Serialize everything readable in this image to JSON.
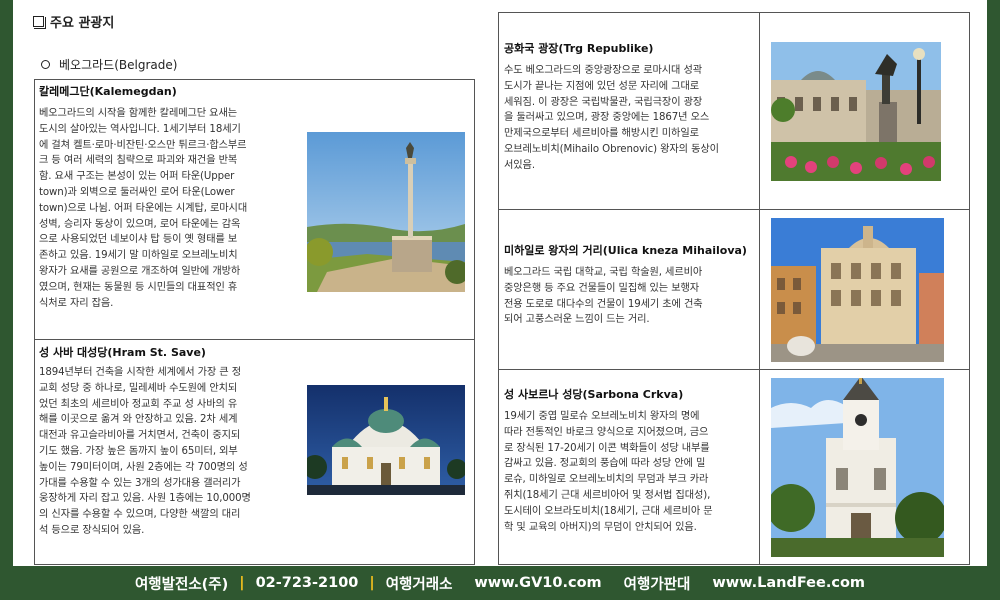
{
  "header": {
    "section_title": "주요 관광지",
    "city_title": "베오그라드(Belgrade)"
  },
  "cards": {
    "kalemegdan": {
      "title": "칼레메그단(Kalemegdan)",
      "lines": [
        "베오그라드의 시작을 함께한 칼레메그단 요새는",
        "도시의 살아있는 역사입니다. 1세기부터 18세기",
        "에 걸쳐 켈트·로마·비잔틴·오스만 튀르크·합스부르",
        "크 등 여러 세력의 침략으로 파괴와 재건을 반복",
        "함.  요새 구조는 본성이 있는 어퍼 타운(Upper",
        "town)과  외벽으로  둘러싸인  로어  타운(Lower",
        "town)으로 나뉨. 어퍼 타운에는 시계탑, 로마시대",
        "성벽, 승리자 동상이 있으며, 로어 타운에는 감옥",
        "으로 사용되었던 네보이샤 탑 등이 옛 형태를 보",
        "존하고 있음. 19세기 말 미하일로 오브레노비치",
        "왕자가 요새를 공원으로 개조하여 일반에 개방하",
        "였으며, 현재는 동물원 등 시민들의 대표적인 휴",
        "식처로 자리 잡음."
      ]
    },
    "sava": {
      "title": "성 사바 대성당(Hram St. Save)",
      "lines": [
        "1894년부터 건축을 시작한 세계에서 가장 큰 정",
        "교회 성당 중 하나로, 밀레셰바 수도원에 안치되",
        "었던 최초의 세르비아 정교회 주교 성 사바의 유",
        "해를 이곳으로 옮겨 와 안장하고 있음. 2차 세계",
        "대전과 유고슬라비아를 거치면서, 건축이 중지되",
        "기도 했음. 가장 높은 돔까지 높이 65미터, 외부",
        "높이는 79미터이며, 사원 2층에는 각 700명의 성",
        "가대를 수용할 수 있는 3개의 성가대용 갤러리가",
        "웅장하게 자리 잡고 있음. 사원 1층에는 10,000명",
        "의 신자를 수용할 수 있으며, 다양한 색깔의 대리",
        "석 등으로 장식되어 있음."
      ]
    },
    "republike": {
      "title": "공화국 광장(Trg Republike)",
      "lines": [
        "수도 베오그라드의 중앙광장으로 로마시대 성곽",
        "도시가 끝나는 지점에 있던 성문 자리에 그대로",
        "세워짐. 이 광장은 국립박물관, 국립극장이 광장",
        "을 둘러싸고 있으며, 광장 중앙에는 1867년 오스",
        "만제국으로부터 세르비아를 해방시킨 미하일로",
        "오브레노비치(Mihailo Obrenovic) 왕자의 동상이",
        "서있음."
      ]
    },
    "mihailova": {
      "title": "미하일로 왕자의 거리(Ulica kneza Mihailova)",
      "lines": [
        "베오그라드 국립 대학교, 국립 학술원, 세르비아",
        "중앙은행 등 주요 건물들이 밀집해 있는 보행자",
        "전용 도로로 대다수의 건물이 19세기 초에 건축",
        "되어 고풍스러운 느낌이 드는 거리."
      ]
    },
    "sabor": {
      "title": "성 사보르나 성당(Sarbona Crkva)",
      "lines": [
        "19세기 중엽 밀로슈 오브레노비치 왕자의 명에",
        "따라 전통적인 바로크 양식으로 지어졌으며, 금으",
        "로 장식된 17-20세기 이콘 벽화들이 성당 내부를",
        "감싸고 있음. 정교회의 풍습에 따라 성당 안에 밀",
        "로슈, 미하일로 오브레노비치의 무덤과 부크 카라",
        "쥐치(18세기 근대 세르비아어 및 정서법 집대성),",
        "도시테이 오브라도비치(18세기, 근대 세르비아 문",
        "학 및 교육의 아버지)의 무덤이 안치되어 있음."
      ]
    }
  },
  "footer": {
    "company": "여행발전소(주)",
    "phone": "02-723-2100",
    "brand1": "여행거래소",
    "site1": "www.GV10.com",
    "brand2": "여행가판대",
    "site2": "www.LandFee.com"
  },
  "icons": {
    "section_marker": "checkbox-square-icon",
    "city_marker": "circle-bullet-icon"
  },
  "colors": {
    "footer_bg": "#2f5730",
    "footer_separator": "#f4c21d"
  }
}
